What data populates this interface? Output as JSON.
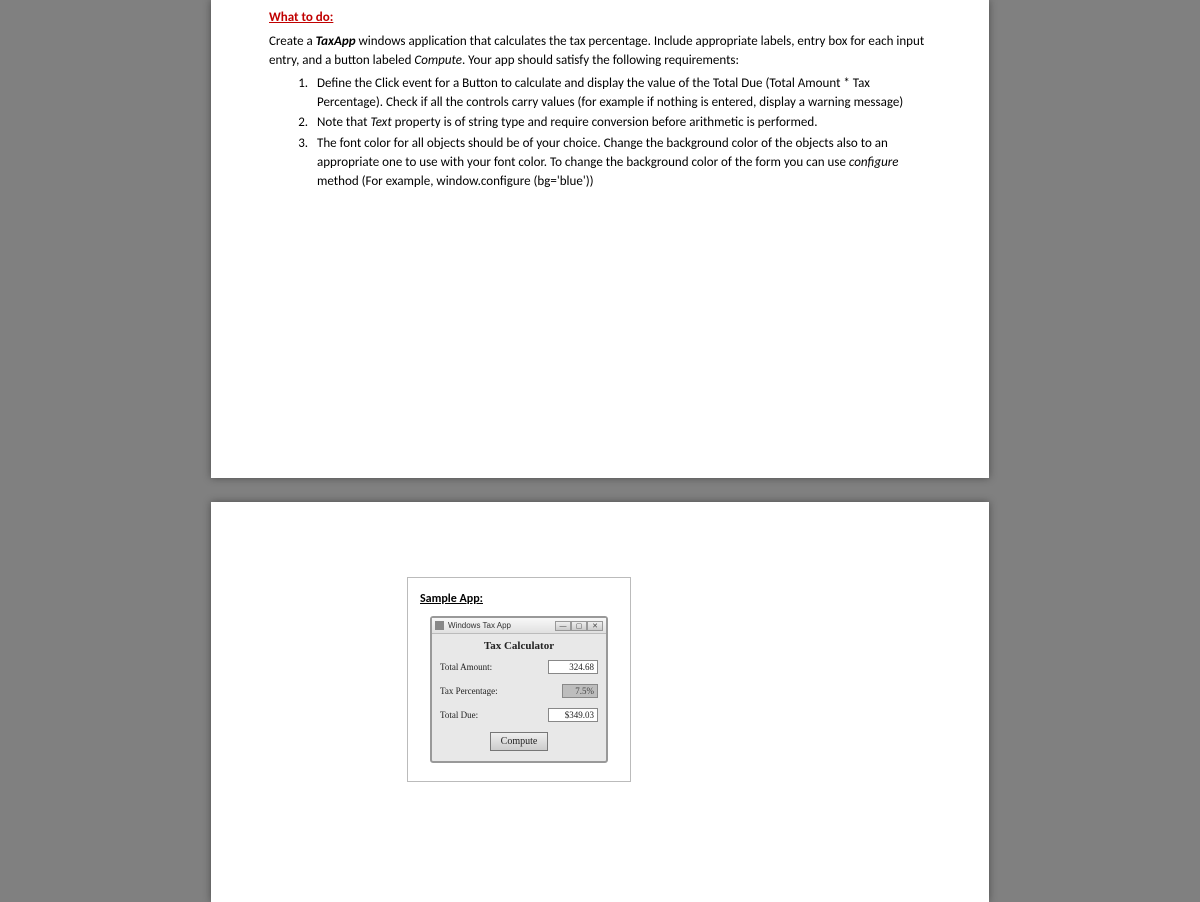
{
  "heading": "What to do:",
  "intro_parts": {
    "a": "Create a ",
    "b": "TaxApp",
    "c": " windows application that calculates the tax percentage. Include appropriate labels, entry box for each input entry, and a button labeled ",
    "d": "Compute",
    "e": ". Your app should satisfy the following requirements:"
  },
  "req1": "Define the Click event for a Button to calculate and display the value of the Total Due (Total Amount * Tax Percentage). Check if all the controls carry values (for example if nothing is entered, display a warning message)",
  "req2": {
    "a": "Note that ",
    "b": "Text",
    "c": " property is of string type and require conversion before arithmetic is performed."
  },
  "req3": {
    "a": "The font color for all objects should be of your choice. Change the background color of the objects also to an appropriate one to use with your font color. To change the background color of the form you can use ",
    "b": "configure",
    "c": " method (For example, window.configure (bg='blue'))"
  },
  "sample_heading": "Sample App:",
  "app": {
    "title": "Windows Tax App",
    "min": "—",
    "max": "▢",
    "close": "✕",
    "calc_title": "Tax Calculator",
    "label_amount": "Total Amount:",
    "value_amount": "324.68",
    "label_percent": "Tax Percentage:",
    "value_percent": "7.5%",
    "label_due": "Total Due:",
    "value_due": "$349.03",
    "compute": "Compute"
  }
}
